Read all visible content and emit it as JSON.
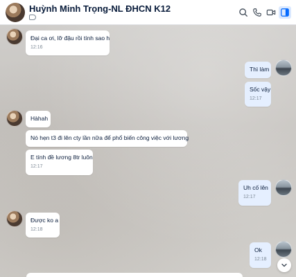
{
  "header": {
    "contact_name": "Huỳnh Minh Trọng-NL ĐHCN K12",
    "icons": [
      "search-icon",
      "phone-icon",
      "video-icon",
      "sidebar-toggle-icon",
      "tag-icon"
    ]
  },
  "colors": {
    "accent": "#0068ff",
    "outgoing_bubble": "#e5efff",
    "incoming_bubble": "#ffffff",
    "text": "#081b3a",
    "time": "#7b8794"
  },
  "messages": [
    {
      "dir": "in",
      "text": "Đại ca ơi, lỡ đậu rồi tính sao h",
      "time": "12:16"
    },
    {
      "dir": "out",
      "text": "Thì làm",
      "time": ""
    },
    {
      "dir": "out",
      "text": "Sốc vậy",
      "time": "12:17"
    },
    {
      "dir": "in",
      "text": "Hàhah",
      "time": ""
    },
    {
      "dir": "in",
      "text": "Nó hẹn t3 đi lên cty lần nữa để phổ biến công việc với lương",
      "time": ""
    },
    {
      "dir": "in",
      "text": "E tính đề lương 8tr luôn",
      "time": "12:17"
    },
    {
      "dir": "out",
      "text": "Uh cố lên",
      "time": "12:17"
    },
    {
      "dir": "in",
      "text": "Được ko a",
      "time": "12:18"
    },
    {
      "dir": "out",
      "text": "Ok",
      "time": "12:18"
    }
  ]
}
